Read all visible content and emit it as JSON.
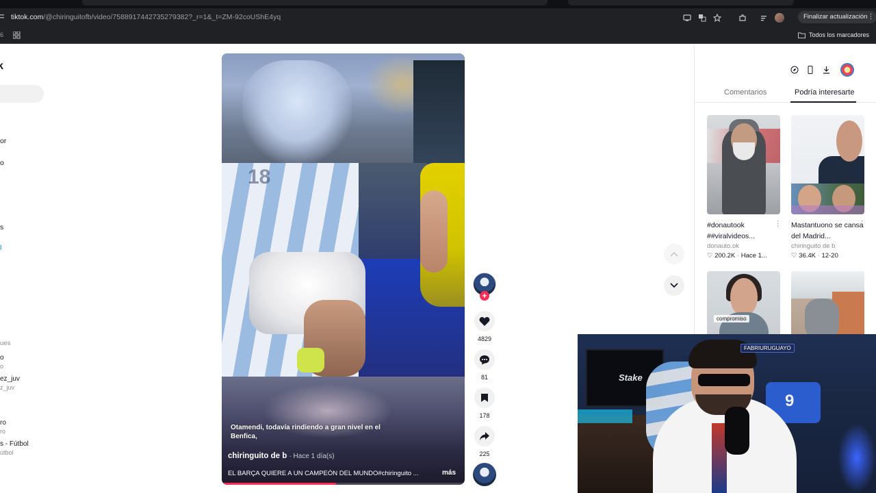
{
  "browser": {
    "url_domain": "tiktok.com",
    "url_path": "/@chiringuitofb/video/7588917442735279382?_r=1&_t=ZM-92coUShE4yq",
    "update_button": "Finalizar actualización",
    "bookmarks_left": "6",
    "all_bookmarks": "Todos los marcadores"
  },
  "sidebar": {
    "logo_fragment": "k",
    "nav_fragments": [
      "or",
      "o",
      "s",
      "l"
    ],
    "following_heading": "ues",
    "accounts": [
      {
        "name": "o",
        "handle": "o"
      },
      {
        "name": "ez_juv",
        "handle": "z_juv"
      },
      {
        "name": "ro",
        "handle": "ro"
      },
      {
        "name": "s - Fútbol",
        "handle": "útbol"
      }
    ]
  },
  "video": {
    "caption": "Otamendi, todavía rindiendo a gran nivel en el Benfica,",
    "author": "chiringuito de b",
    "time": "· Hace 1 día(s)",
    "description": "EL BARÇA QUIERE A UN CAMPEÓN DEL MUNDO#chiringuito ...",
    "more": "más",
    "progress": 0.47,
    "jersey_number": "18"
  },
  "actions": {
    "likes": "4829",
    "comments": "81",
    "saves": "178",
    "shares": "225"
  },
  "right_panel": {
    "tabs": [
      "Comentarios",
      "Podría interesarte"
    ],
    "active_tab": 1,
    "cards": [
      {
        "title": "#donautook ##viralvideos...",
        "author": "donauto.ok",
        "likes": "200.2K",
        "date": "Hace 1..."
      },
      {
        "title": "Mastantuono se cansa del Madrid...",
        "author": "chiringuito de b",
        "likes": "36.4K",
        "date": "12-20"
      },
      {
        "tag": "compromiso"
      },
      {}
    ]
  },
  "webcam": {
    "tv_logo": "Stake",
    "name_tag": "FABRIURUGUAYO",
    "jersey_number": "9"
  },
  "colors": {
    "accent": "#fe2c55",
    "chrome_bg": "#202124",
    "text_primary": "#161823",
    "text_secondary": "#8a8b91"
  }
}
